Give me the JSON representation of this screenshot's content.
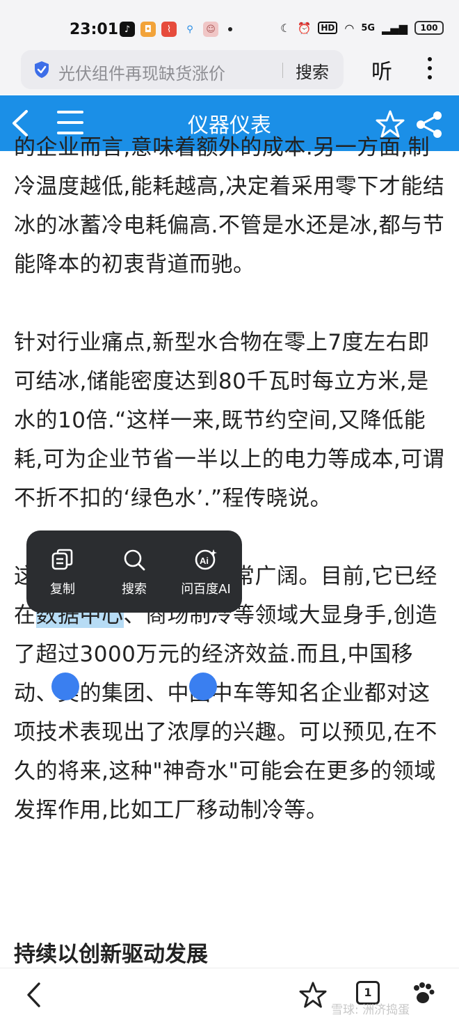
{
  "status_bar": {
    "time": "23:01",
    "network": "5G",
    "signal_bars": "4G",
    "battery": "100"
  },
  "search": {
    "placeholder": "光伏组件再现缺货涨价",
    "button": "搜索"
  },
  "top_actions": {
    "listen": "听"
  },
  "header": {
    "title": "仪器仪表"
  },
  "article": {
    "paragraphs": [
      "的企业而言,意味着额外的成本.另一方面,制冷温度越低,能耗越高,决定着采用零下才能结冰的冰蓄冷电耗偏高.不管是水还是冰,都与节能降本的初衷背道而驰。",
      "针对行业痛点,新型水合物在零上7度左右即可结冰,储能密度达到80千瓦时每立方米,是水的10倍.“这样一来,既节约空间,又降低能耗,可为企业节省一半以上的电力等成本,可谓不折不扣的‘绿色水’.”程传晓说。"
    ],
    "para3": {
      "before": "这项技术的应用前景非常广阔。目前,它已经在",
      "highlight": "数据中心",
      "after": "、商场制冷等领域大显身手,创造了超过3000万元的经济效益.而且,中国移动、美的集团、中国中车等知名企业都对这项技术表现出了浓厚的兴趣。可以预见,在不久的将来,这种\"神奇水\"可能会在更多的领域发挥作用,比如工厂移动制冷等。"
    },
    "section_title": "持续以创新驱动发展"
  },
  "context_menu": {
    "items": [
      {
        "label": "复制",
        "icon": "copy-icon"
      },
      {
        "label": "搜索",
        "icon": "search-icon"
      },
      {
        "label": "问百度AI",
        "icon": "ai-icon"
      }
    ]
  },
  "bottom_nav": {
    "tab_count": "1"
  },
  "watermark": "雪球: 洲济捣蛋",
  "colors": {
    "header": "#1b8fe7",
    "highlight": "#b7dcf5",
    "handle": "#3a7ff0",
    "popup": "#2b2d30"
  }
}
